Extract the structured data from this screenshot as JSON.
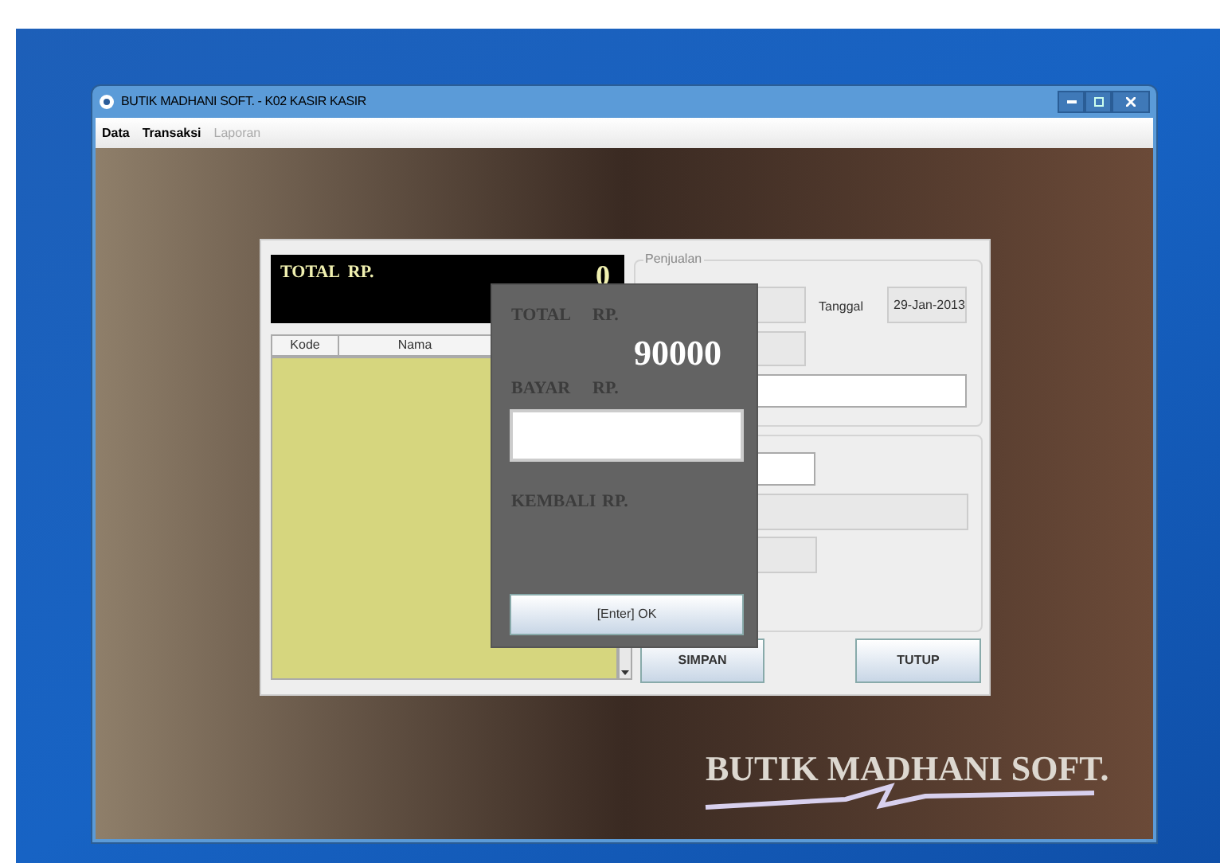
{
  "window": {
    "title": "BUTIK MADHANI SOFT. - K02 KASIR KASIR"
  },
  "menu": [
    {
      "label": "Data",
      "disabled": false
    },
    {
      "label": "Transaksi",
      "disabled": false
    },
    {
      "label": "Laporan",
      "disabled": true
    }
  ],
  "sales_form": {
    "total_label": "TOTAL  RP.",
    "total_value": "0",
    "table": {
      "columns": [
        "Kode",
        "Nama"
      ]
    },
    "group_title": "Penjualan",
    "date_label": "Tanggal",
    "date_value": "29-Jan-2013",
    "buttons": [
      "SIMPAN",
      "TUTUP"
    ]
  },
  "payment_dialog": {
    "total_label": "TOTAL",
    "total_currency": "RP.",
    "total_value": "90000",
    "pay_label": "BAYAR",
    "pay_currency": "RP.",
    "change_label": "KEMBALI",
    "change_currency": "RP.",
    "ok_button": "[Enter] OK"
  },
  "brand": "BUTIK MADHANI SOFT."
}
